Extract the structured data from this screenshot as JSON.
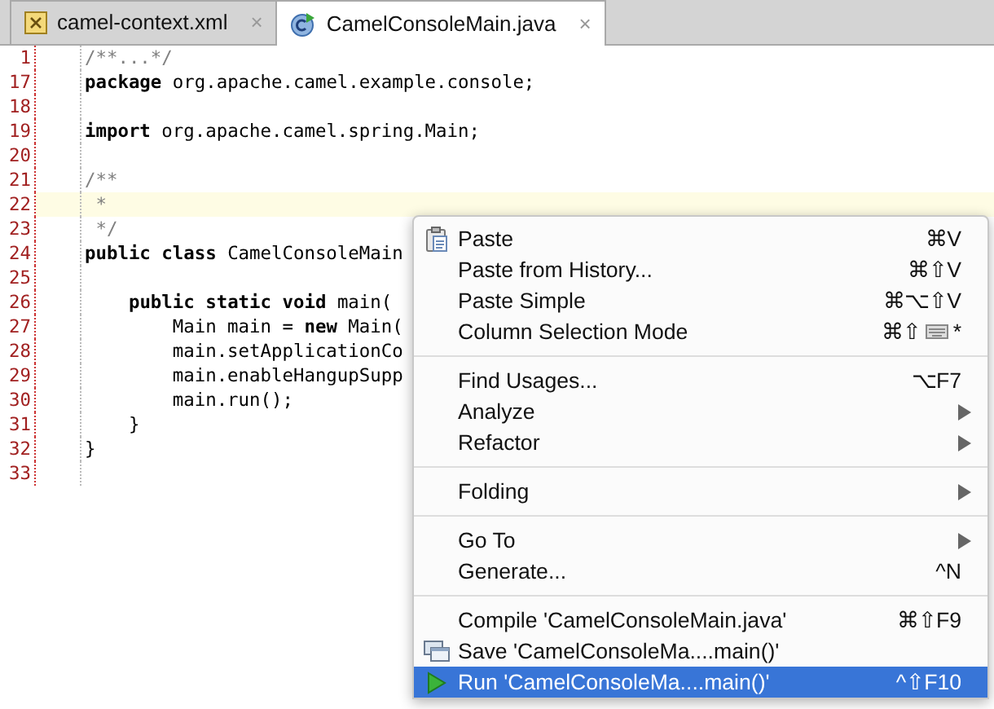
{
  "tabs": [
    {
      "label": "camel-context.xml",
      "kind": "xml",
      "close": "×",
      "selected": false
    },
    {
      "label": "CamelConsoleMain.java",
      "kind": "java",
      "close": "×",
      "selected": true
    }
  ],
  "editor": {
    "lines": [
      {
        "number": "1",
        "text": "/**...*/",
        "kind": "comment",
        "current": false
      },
      {
        "number": "17",
        "text": "**package** org.apache.camel.example.console;",
        "kind": "code",
        "current": false
      },
      {
        "number": "18",
        "current": false
      },
      {
        "number": "19",
        "text": "**import** org.apache.camel.spring.Main;",
        "kind": "code",
        "current": false
      },
      {
        "number": "20",
        "current": false
      },
      {
        "number": "21",
        "text": "/**",
        "kind": "comment",
        "current": false
      },
      {
        "number": "22",
        "text": " *",
        "kind": "comment",
        "current": true
      },
      {
        "number": "23",
        "text": " */",
        "kind": "comment",
        "current": false
      },
      {
        "number": "24",
        "text": "**public class** CamelConsoleMain",
        "kind": "code",
        "current": false
      },
      {
        "number": "25",
        "current": false
      },
      {
        "number": "26",
        "text": "    **public static void** main(",
        "kind": "code",
        "current": false
      },
      {
        "number": "27",
        "text": "        Main main = **new** Main(",
        "kind": "code",
        "current": false
      },
      {
        "number": "28",
        "text": "        main.setApplicationCo",
        "kind": "code",
        "current": false
      },
      {
        "number": "29",
        "text": "        main.enableHangupSupp",
        "kind": "code",
        "current": false
      },
      {
        "number": "30",
        "text": "        main.run();",
        "kind": "code",
        "current": false
      },
      {
        "number": "31",
        "text": "    }",
        "kind": "code",
        "current": false
      },
      {
        "number": "32",
        "text": "}",
        "kind": "code",
        "current": false
      },
      {
        "number": "33",
        "current": false
      }
    ]
  },
  "context_menu": {
    "groups": [
      [
        {
          "label": "Paste",
          "shortcut": "⌘V",
          "submenu": false,
          "selected": false
        },
        {
          "label": "Paste from History...",
          "shortcut": "⌘⇧V",
          "submenu": false,
          "selected": false
        },
        {
          "label": "Paste Simple",
          "shortcut": "⌘⌥⇧V",
          "submenu": false,
          "selected": false
        },
        {
          "label": "Column Selection Mode",
          "shortcut": "⌘⇧",
          "shortcut_suffix": "*",
          "keyboard_icon": true,
          "submenu": false,
          "selected": false
        }
      ],
      [
        {
          "label": "Find Usages...",
          "shortcut": "⌥F7",
          "submenu": false,
          "selected": false
        },
        {
          "label": "Analyze",
          "submenu": true,
          "selected": false
        },
        {
          "label": "Refactor",
          "submenu": true,
          "selected": false
        }
      ],
      [
        {
          "label": "Folding",
          "submenu": true,
          "selected": false
        }
      ],
      [
        {
          "label": "Go To",
          "submenu": true,
          "selected": false
        },
        {
          "label": "Generate...",
          "shortcut": "^N",
          "submenu": false,
          "selected": false
        }
      ],
      [
        {
          "label": "Compile 'CamelConsoleMain.java'",
          "shortcut": "⌘⇧F9",
          "submenu": false,
          "selected": false
        },
        {
          "label": "Save 'CamelConsoleMa....main()'",
          "submenu": false,
          "selected": false
        },
        {
          "label": "Run 'CamelConsoleMa....main()'",
          "shortcut": "^⇧F10",
          "submenu": false,
          "selected": true
        }
      ]
    ]
  }
}
